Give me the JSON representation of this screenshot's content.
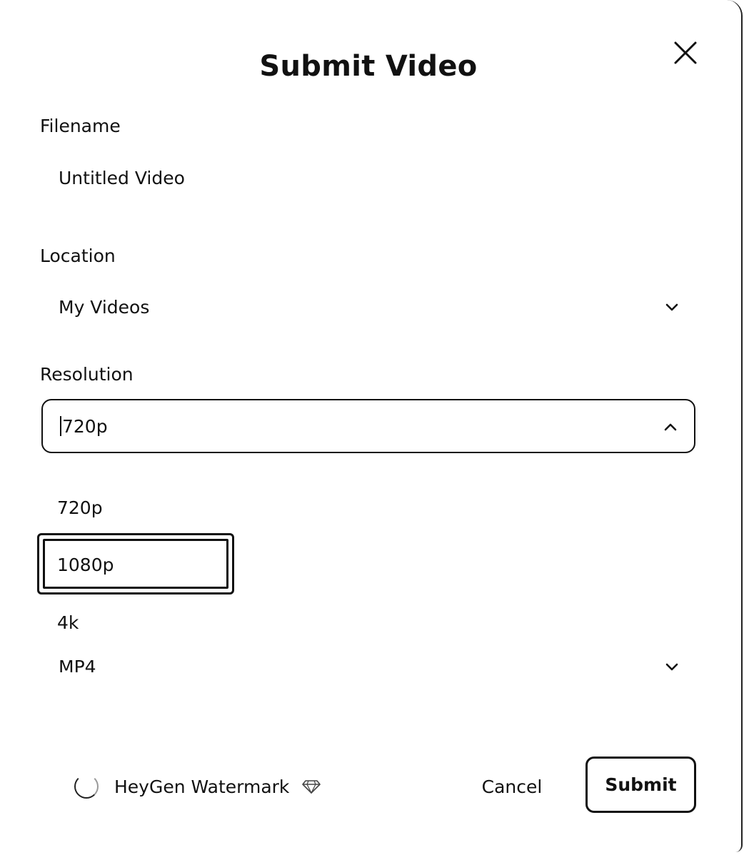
{
  "dialog": {
    "title": "Submit Video"
  },
  "filename": {
    "label": "Filename",
    "value": "Untitled Video"
  },
  "location": {
    "label": "Location",
    "value": "My Videos"
  },
  "resolution": {
    "label": "Resolution",
    "value": "720p",
    "options": [
      "720p",
      "1080p",
      "4k"
    ],
    "highlighted_option": "1080p"
  },
  "format": {
    "value": "MP4"
  },
  "watermark": {
    "label": "HeyGen Watermark",
    "icon": "gem-icon"
  },
  "actions": {
    "cancel_label": "Cancel",
    "submit_label": "Submit"
  },
  "colors": {
    "text": "#111111",
    "background": "#ffffff"
  }
}
